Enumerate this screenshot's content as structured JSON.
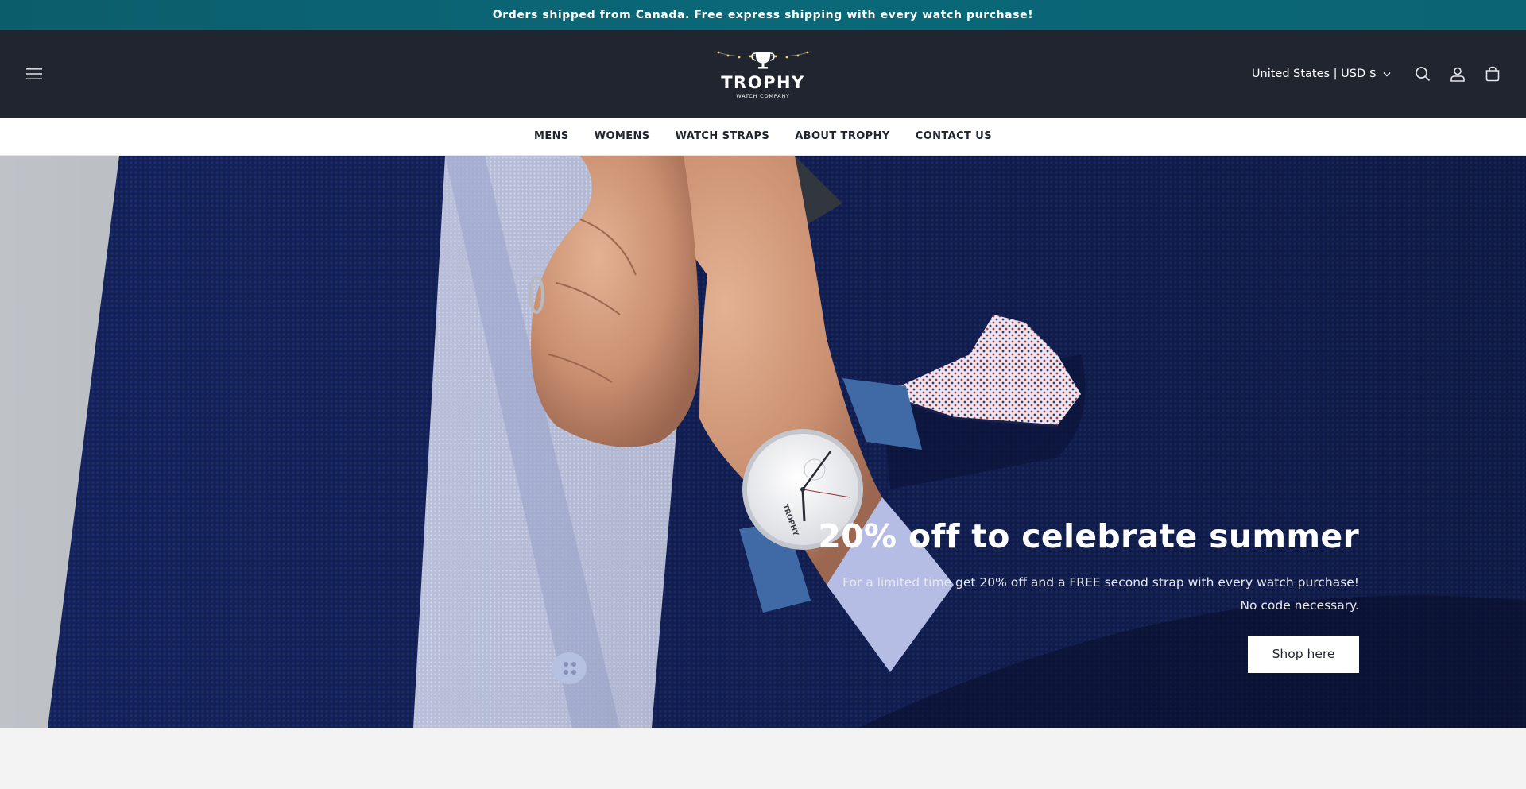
{
  "announcement": {
    "text": "Orders shipped from Canada. Free express shipping with every watch purchase!"
  },
  "header": {
    "logo_text": "TROPHY",
    "logo_subtext": "WATCH COMPANY",
    "localization": "United States | USD $",
    "icons": [
      "menu-icon",
      "search-icon",
      "account-icon",
      "cart-icon"
    ]
  },
  "nav": {
    "items": [
      {
        "label": "MENS"
      },
      {
        "label": "WOMENS"
      },
      {
        "label": "WATCH STRAPS"
      },
      {
        "label": "ABOUT TROPHY"
      },
      {
        "label": "CONTACT US"
      }
    ]
  },
  "hero": {
    "title": "20% off to celebrate summer",
    "subtitle_line1": "For a limited time get 20% off and a FREE second strap with every watch purchase!",
    "subtitle_line2": "No code necessary.",
    "button_label": "Shop here",
    "watch_brand": "TROPHY"
  },
  "colors": {
    "announcement_bg": "#0a6878",
    "header_bg": "#21252f",
    "nav_bg": "#ffffff",
    "hero_blazer": "#0f1a42",
    "button_bg": "#ffffff"
  }
}
